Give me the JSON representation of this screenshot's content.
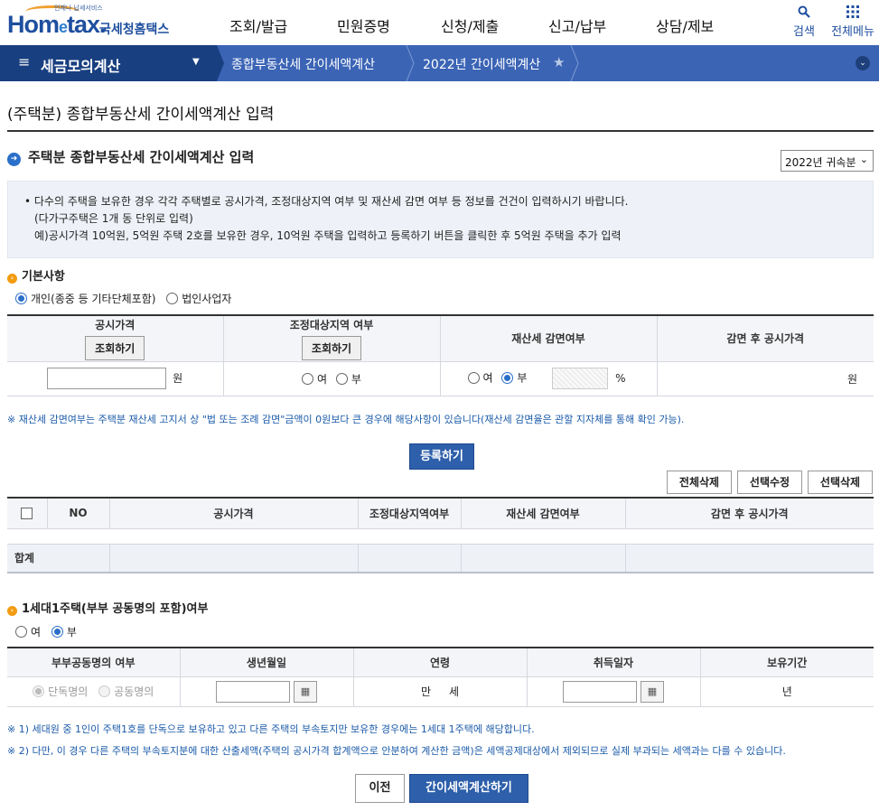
{
  "header": {
    "logo_tiny": "언제나 납세서비스",
    "logo_main": "Hom",
    "logo_e": "e",
    "logo_tail": "tax.",
    "logo_kr": "국세청홈택스",
    "gnb": [
      "조회/발급",
      "민원증명",
      "신청/제출",
      "신고/납부",
      "상담/제보"
    ],
    "search": "검색",
    "allmenu": "전체메뉴"
  },
  "nav": {
    "menu_glyph": "≡",
    "title": "세금모의계산",
    "caret": "▼",
    "crumbs": [
      "종합부동산세 간이세액계산",
      "2022년 간이세액계산"
    ],
    "star": "★",
    "circle": "⌄"
  },
  "page": {
    "title": "(주택분) 종합부동산세 간이세액계산 입력",
    "section": "주택분 종합부동산세 간이세액계산 입력",
    "year_select": "2022년 귀속분",
    "info": [
      "• 다수의 주택을 보유한 경우 각각 주택별로 공시가격, 조정대상지역 여부 및 재산세 감면 여부 등 정보를 건건이 입력하시기 바랍니다.",
      "(다가구주택은 1개 동 단위로 입력)",
      "예)공시가격 10억원, 5억원 주택 2호를 보유한 경우, 10억원 주택을 입력하고 등록하기 버튼을 클릭한 후 5억원 주택을 추가 입력"
    ]
  },
  "basic": {
    "heading": "기본사항",
    "opt_individual": "개인(종중 등 기타단체포함)",
    "opt_corp": "법인사업자",
    "col_price": "공시가격",
    "col_region": "조정대상지역 여부",
    "col_reduce": "재산세 감면여부",
    "col_after": "감면 후 공시가격",
    "lookup": "조회하기",
    "won": "원",
    "yes": "여",
    "no": "부",
    "pct": "%",
    "note": "※ 재산세 감면여부는 주택분 재산세 고지서 상 \"법 또는 조례 감면\"금액이 0원보다 큰 경우에 해당사항이 있습니다(재산세 감면율은 관할 지자체를 통해 확인 가능)."
  },
  "actions": {
    "register": "등록하기",
    "delete_all": "전체삭제",
    "edit_sel": "선택수정",
    "delete_sel": "선택삭제"
  },
  "list": {
    "cols": [
      "NO",
      "공시가격",
      "조정대상지역여부",
      "재산세 감면여부",
      "감면 후 공시가격"
    ],
    "total": "합계"
  },
  "onehouse": {
    "heading": "1세대1주택(부부 공동명의 포함)여부",
    "yes": "여",
    "no": "부",
    "cols": [
      "부부공동명의 여부",
      "생년월일",
      "연령",
      "취득일자",
      "보유기간"
    ],
    "single": "단독명의",
    "joint": "공동명의",
    "man": "만",
    "se": "세",
    "nyeon": "년",
    "cal_glyph": "▦"
  },
  "footnotes": [
    "※ 1) 세대원 중 1인이 주택1호를 단독으로 보유하고 있고 다른 주택의 부속토지만 보유한 경우에는 1세대 1주택에 해당합니다.",
    "※ 2) 다만, 이 경우 다른 주택의 부속토지분에 대한 산출세액(주택의 공시가격 합계액으로 안분하여 계산한 금액)은 세액공제대상에서 제외되므로 실제 부과되는 세액과는 다를 수 있습니다."
  ],
  "bottom": {
    "prev": "이전",
    "calc": "간이세액계산하기"
  },
  "colors": {
    "navy": "#183f80",
    "nav_blue": "#3b64b5",
    "btn_blue": "#2e5faa",
    "note_blue": "#1a5aa8"
  }
}
